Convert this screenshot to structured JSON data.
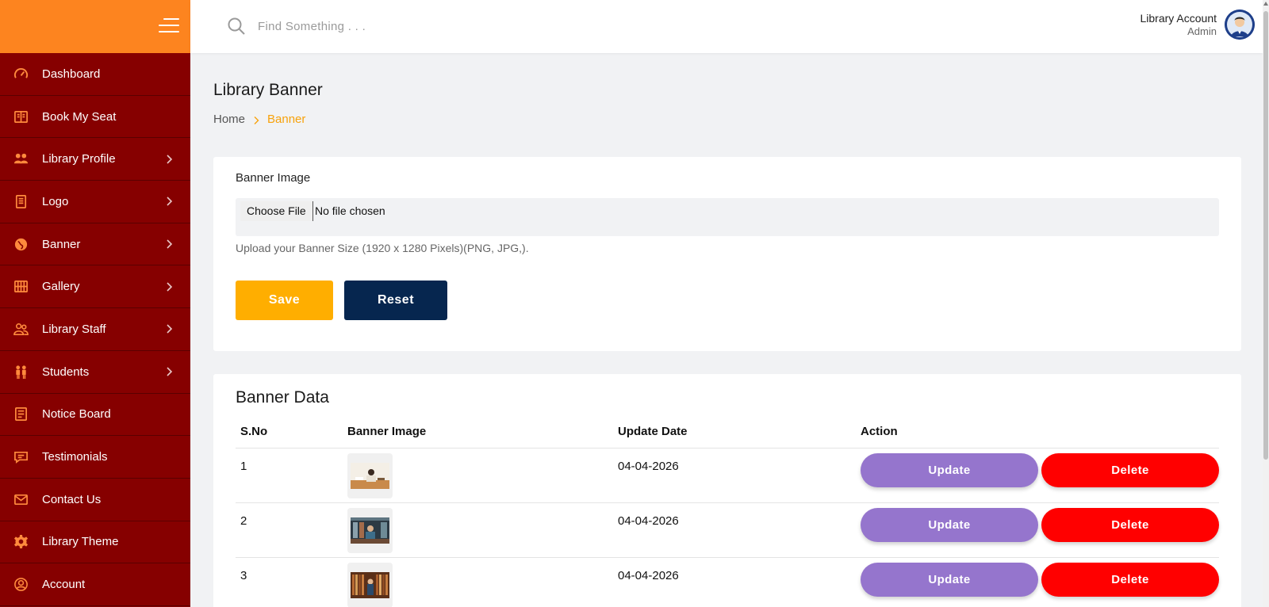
{
  "header": {
    "search_placeholder": "Find Something . . .",
    "account_name": "Library Account",
    "account_role": "Admin"
  },
  "sidebar": {
    "items": [
      {
        "label": "Dashboard",
        "icon": "dashboard-icon",
        "has_submenu": false
      },
      {
        "label": "Book My Seat",
        "icon": "book-icon",
        "has_submenu": false
      },
      {
        "label": "Library Profile",
        "icon": "users-icon",
        "has_submenu": true
      },
      {
        "label": "Logo",
        "icon": "document-icon",
        "has_submenu": true
      },
      {
        "label": "Banner",
        "icon": "globe-icon",
        "has_submenu": true
      },
      {
        "label": "Gallery",
        "icon": "gallery-icon",
        "has_submenu": true
      },
      {
        "label": "Library Staff",
        "icon": "staff-icon",
        "has_submenu": true
      },
      {
        "label": "Students",
        "icon": "students-icon",
        "has_submenu": true
      },
      {
        "label": "Notice Board",
        "icon": "notice-icon",
        "has_submenu": false
      },
      {
        "label": "Testimonials",
        "icon": "chat-icon",
        "has_submenu": false
      },
      {
        "label": "Contact Us",
        "icon": "mail-icon",
        "has_submenu": false
      },
      {
        "label": "Library Theme",
        "icon": "gear-icon",
        "has_submenu": false
      },
      {
        "label": "Account",
        "icon": "account-icon",
        "has_submenu": false
      }
    ]
  },
  "page": {
    "title": "Library Banner",
    "breadcrumb_home": "Home",
    "breadcrumb_current": "Banner"
  },
  "upload": {
    "label": "Banner Image",
    "choose_file": "Choose File",
    "file_status": "No file chosen",
    "helper": "Upload your Banner Size (1920 x 1280 Pixels)(PNG, JPG,).",
    "save_label": "Save",
    "reset_label": "Reset"
  },
  "table": {
    "title": "Banner Data",
    "headers": {
      "sno": "S.No",
      "image": "Banner Image",
      "date": "Update Date",
      "action": "Action"
    },
    "rows": [
      {
        "sno": "1",
        "date": "04-04-2026",
        "update": "Update",
        "delete": "Delete"
      },
      {
        "sno": "2",
        "date": "04-04-2026",
        "update": "Update",
        "delete": "Delete"
      },
      {
        "sno": "3",
        "date": "04-04-2026",
        "update": "Update",
        "delete": "Delete"
      }
    ]
  },
  "colors": {
    "sidebar_bg": "#860000",
    "sidebar_top": "#fd841f",
    "icon_accent": "#ff8a3d",
    "save": "#ffae00",
    "reset": "#06264f",
    "update": "#9575cd",
    "delete": "#ff0000",
    "breadcrumb_active": "#f7a20b"
  }
}
